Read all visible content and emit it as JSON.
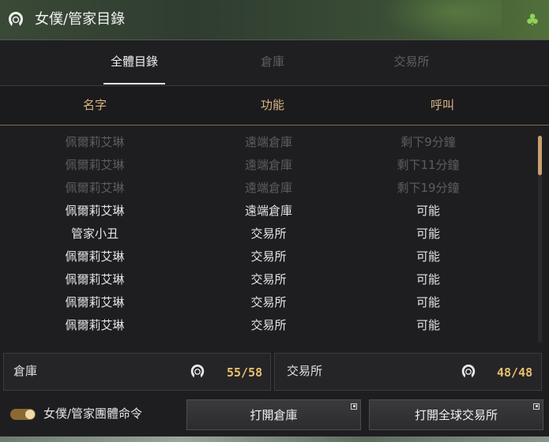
{
  "window": {
    "title": "女僕/管家目錄",
    "icon": "maid-head-icon",
    "corner_icon": "clover-icon"
  },
  "tabs": [
    {
      "label": "全體目錄",
      "active": true
    },
    {
      "label": "倉庫",
      "active": false
    },
    {
      "label": "交易所",
      "active": false
    }
  ],
  "columns": {
    "name": "名字",
    "function": "功能",
    "call": "呼叫"
  },
  "rows": [
    {
      "name": "佩爾莉艾琳",
      "function": "遠端倉庫",
      "call": "剩下9分鐘",
      "available": false
    },
    {
      "name": "佩爾莉艾琳",
      "function": "遠端倉庫",
      "call": "剩下11分鐘",
      "available": false
    },
    {
      "name": "佩爾莉艾琳",
      "function": "遠端倉庫",
      "call": "剩下19分鐘",
      "available": false
    },
    {
      "name": "佩爾莉艾琳",
      "function": "遠端倉庫",
      "call": "可能",
      "available": true
    },
    {
      "name": "管家小丑",
      "function": "交易所",
      "call": "可能",
      "available": true
    },
    {
      "name": "佩爾莉艾琳",
      "function": "交易所",
      "call": "可能",
      "available": true
    },
    {
      "name": "佩爾莉艾琳",
      "function": "交易所",
      "call": "可能",
      "available": true
    },
    {
      "name": "佩爾莉艾琳",
      "function": "交易所",
      "call": "可能",
      "available": true
    },
    {
      "name": "佩爾莉艾琳",
      "function": "交易所",
      "call": "可能",
      "available": true
    }
  ],
  "summary": {
    "warehouse": {
      "label": "倉庫",
      "count": "55/58"
    },
    "exchange": {
      "label": "交易所",
      "count": "48/48"
    }
  },
  "footer": {
    "toggle_label": "女僕/管家團體命令",
    "toggle_on": true,
    "open_warehouse": "打開倉庫",
    "open_exchange": "打開全球交易所"
  },
  "colors": {
    "accent": "#d9b582",
    "count": "#e8c070",
    "dim_text": "#5d5d60"
  }
}
